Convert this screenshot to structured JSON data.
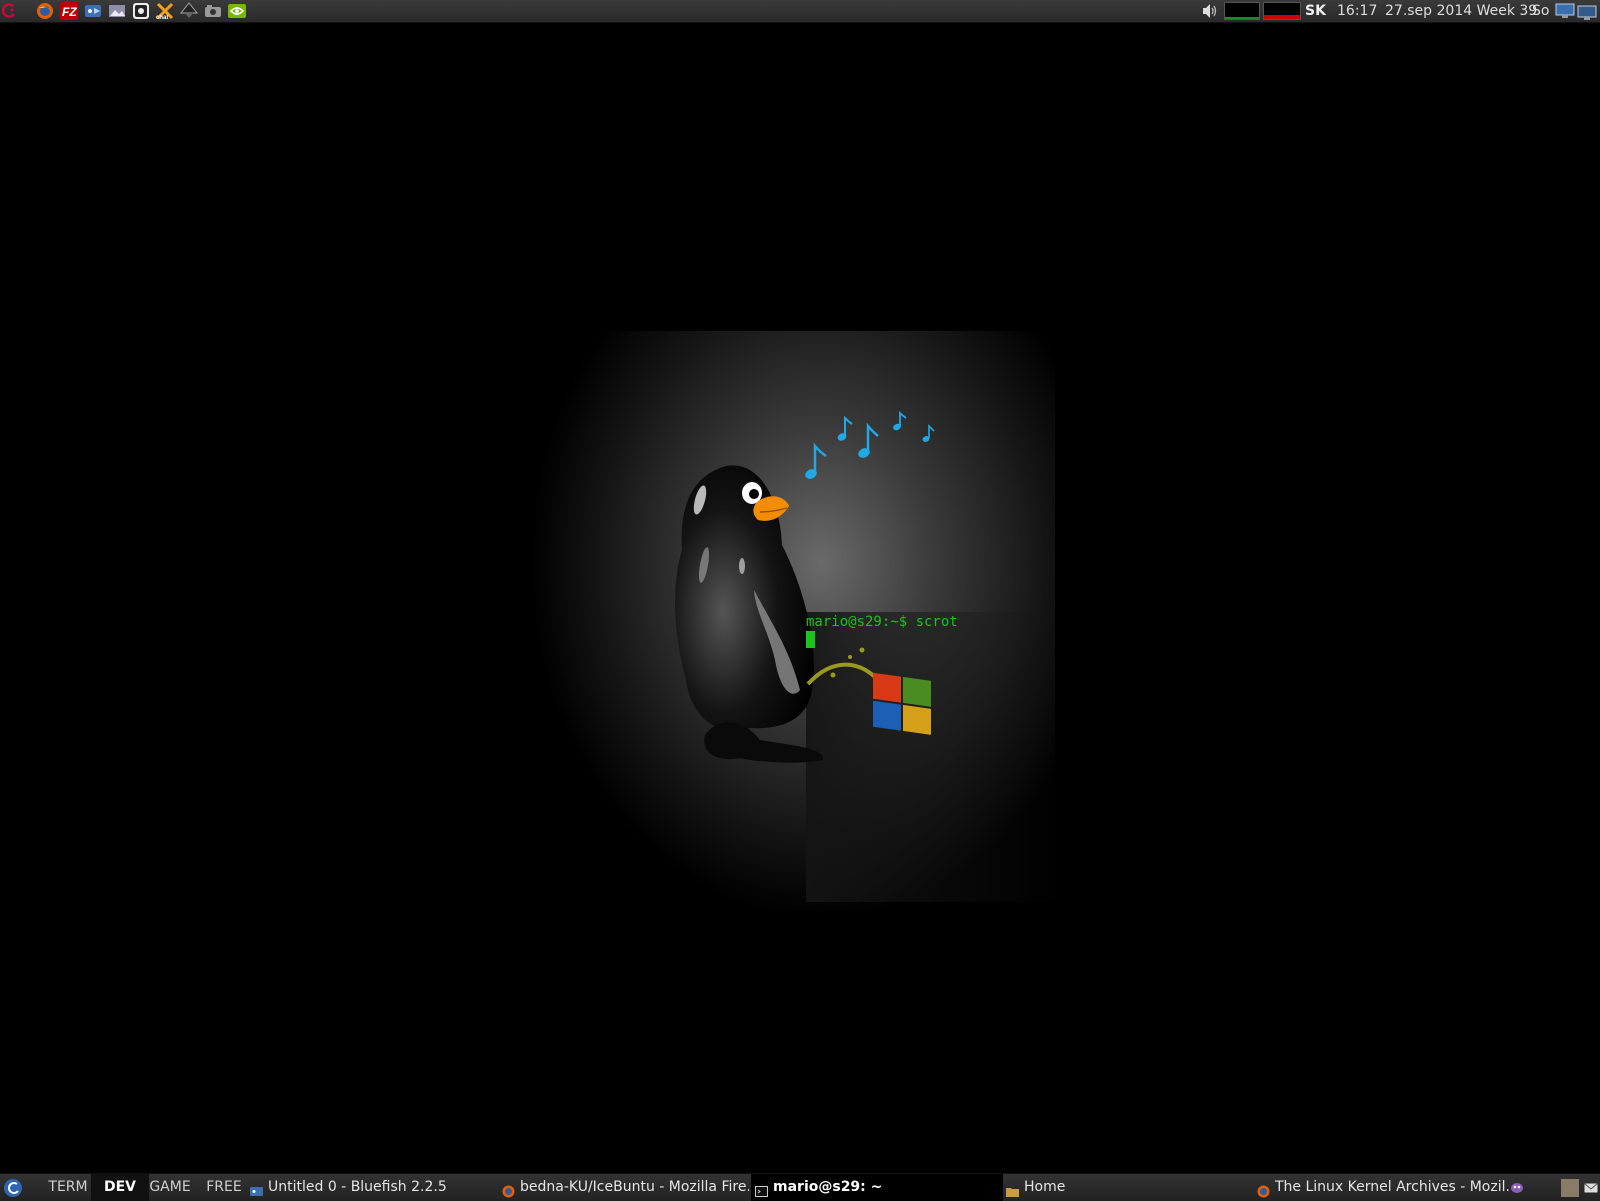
{
  "top_panel": {
    "launchers": [
      {
        "icon": "debian-swirl-icon"
      },
      {
        "icon": "firefox-icon"
      },
      {
        "icon": "filezilla-icon"
      },
      {
        "icon": "bluefish-icon"
      },
      {
        "icon": "image-viewer-icon"
      },
      {
        "icon": "audio-app-icon"
      },
      {
        "icon": "chat-app-icon"
      },
      {
        "icon": "inkscape-icon"
      },
      {
        "icon": "camera-app-icon"
      },
      {
        "icon": "nvidia-icon"
      }
    ],
    "tray": {
      "volume_icon": "speaker-icon",
      "keyboard_layout": "SK",
      "time": "16:17",
      "date": "27.sep 2014 Week 39",
      "day": "So",
      "network_icon": "network-icon"
    }
  },
  "desktop": {
    "terminal_prompt": "mario@s29:~$ scrot"
  },
  "taskbar": {
    "menu_icon": "debian-menu-icon",
    "workspaces": [
      "TERM",
      "DEV",
      "GAME",
      "FREE"
    ],
    "active_workspace": "DEV",
    "tasks": [
      {
        "label": "Untitled 0 - Bluefish 2.2.5",
        "icon": "bluefish-icon"
      },
      {
        "label": "bedna-KU/IceBuntu - Mozilla Fire...",
        "icon": "firefox-icon"
      },
      {
        "label": "mario@s29: ~",
        "icon": "terminal-icon",
        "active": true
      },
      {
        "label": "Home",
        "icon": "folder-icon"
      },
      {
        "label": "The Linux Kernel Archives - Mozil...",
        "icon": "firefox-icon"
      }
    ],
    "tray_icons": [
      "pidgin-icon",
      "desktop-show-icon",
      "mail-icon"
    ]
  }
}
